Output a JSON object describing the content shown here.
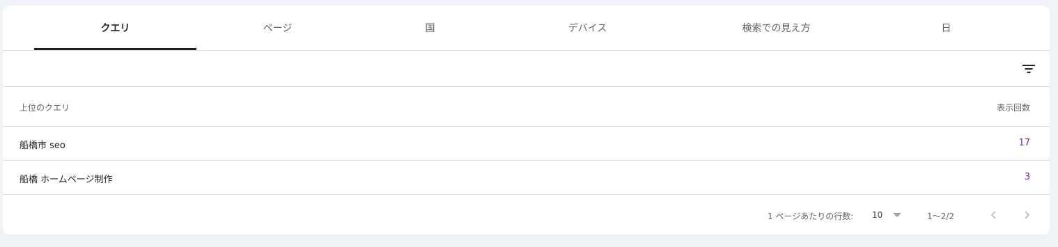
{
  "tabs": [
    {
      "label": "クエリ",
      "active": true
    },
    {
      "label": "ページ",
      "active": false
    },
    {
      "label": "国",
      "active": false
    },
    {
      "label": "デバイス",
      "active": false
    },
    {
      "label": "検索での見え方",
      "active": false
    },
    {
      "label": "日",
      "active": false
    }
  ],
  "toolbar": {
    "filter_icon": "filter-list-icon"
  },
  "table": {
    "columns": [
      "上位のクエリ",
      "表示回数"
    ],
    "rows": [
      {
        "query": "船橋市 seo",
        "impressions": "17"
      },
      {
        "query": "船橋 ホームページ制作",
        "impressions": "3"
      }
    ]
  },
  "pagination": {
    "rows_per_page_label": "1 ページあたりの行数:",
    "rows_per_page_value": "10",
    "range": "1〜2/2",
    "prev_icon": "chevron-left-icon",
    "next_icon": "chevron-right-icon"
  },
  "colors": {
    "accent_value": "#7b1fa2",
    "active_tab": "#202124",
    "background": "#eff2f7"
  }
}
